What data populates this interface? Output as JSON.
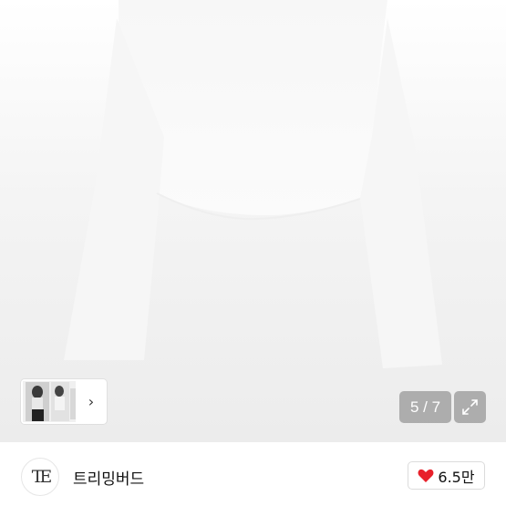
{
  "gallery": {
    "page_counter": "5 / 7",
    "thumb_next_icon": "chevron-right-icon",
    "expand_icon": "expand-icon"
  },
  "store": {
    "logo_text": "TE",
    "name": "트리밍버드",
    "like_count": "6.5만",
    "like_icon": "heart-icon",
    "heart_color": "#e8202a"
  }
}
